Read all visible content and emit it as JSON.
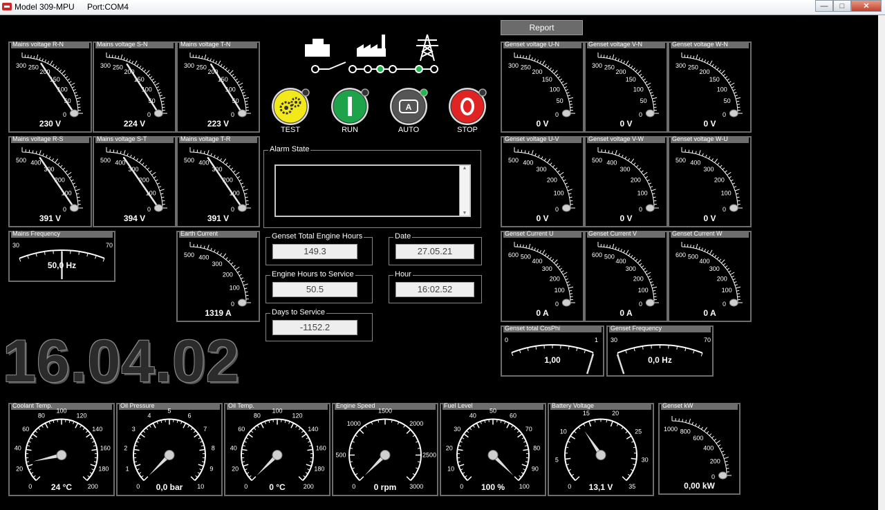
{
  "window": {
    "title": "Model 309-MPU",
    "port": "Port:COM4"
  },
  "report_label": "Report",
  "clock": "16.04.02",
  "modes": [
    {
      "label": "TEST",
      "color": "#f2e81a",
      "icon": "gears-icon"
    },
    {
      "label": "RUN",
      "color": "#1ea34a",
      "icon": "run-icon"
    },
    {
      "label": "AUTO",
      "color": "#555555",
      "icon": "auto-icon"
    },
    {
      "label": "STOP",
      "color": "#e02424",
      "icon": "stop-icon"
    }
  ],
  "alarm_state": {
    "label": "Alarm State",
    "value": ""
  },
  "fields": [
    {
      "id": "engine-hours",
      "label": "Genset Total Engine Hours",
      "value": "149.3"
    },
    {
      "id": "date",
      "label": "Date",
      "value": "27.05.21"
    },
    {
      "id": "service-hours",
      "label": "Engine Hours to Service",
      "value": "50.5"
    },
    {
      "id": "hour",
      "label": "Hour",
      "value": "16:02.52"
    },
    {
      "id": "days-service",
      "label": "Days to Service",
      "value": "-1152.2"
    }
  ],
  "mains_gauges": [
    {
      "title": "Mains voltage R-N",
      "ticks": [
        "0",
        "50",
        "100",
        "150",
        "200",
        "250",
        "300"
      ],
      "max": 300,
      "value": 230,
      "display": "230 V"
    },
    {
      "title": "Mains voltage S-N",
      "ticks": [
        "0",
        "50",
        "100",
        "150",
        "200",
        "250",
        "300"
      ],
      "max": 300,
      "value": 224,
      "display": "224 V"
    },
    {
      "title": "Mains voltage T-N",
      "ticks": [
        "0",
        "50",
        "100",
        "150",
        "200",
        "250",
        "300"
      ],
      "max": 300,
      "value": 223,
      "display": "223 V"
    },
    {
      "title": "Mains voltage R-S",
      "ticks": [
        "0",
        "100",
        "200",
        "300",
        "400",
        "500"
      ],
      "max": 500,
      "value": 391,
      "display": "391 V"
    },
    {
      "title": "Mains voltage S-T",
      "ticks": [
        "0",
        "100",
        "200",
        "300",
        "400",
        "500"
      ],
      "max": 500,
      "value": 394,
      "display": "394 V"
    },
    {
      "title": "Mains voltage T-R",
      "ticks": [
        "0",
        "100",
        "200",
        "300",
        "400",
        "500"
      ],
      "max": 500,
      "value": 391,
      "display": "391 V"
    },
    {
      "title": "Earth Current",
      "ticks": [
        "0",
        "100",
        "200",
        "300",
        "400",
        "500"
      ],
      "max": 500,
      "value": 0,
      "display": "1319 A"
    }
  ],
  "genset_gauges": [
    {
      "title": "Genset voltage U-N",
      "ticks": [
        "0",
        "50",
        "100",
        "150",
        "200",
        "250",
        "300"
      ],
      "max": 300,
      "value": 0,
      "display": "0 V"
    },
    {
      "title": "Genset voltage V-N",
      "ticks": [
        "0",
        "50",
        "100",
        "150",
        "200",
        "250",
        "300"
      ],
      "max": 300,
      "value": 0,
      "display": "0 V"
    },
    {
      "title": "Genset voltage W-N",
      "ticks": [
        "0",
        "50",
        "100",
        "150",
        "200",
        "250",
        "300"
      ],
      "max": 300,
      "value": 0,
      "display": "0 V"
    },
    {
      "title": "Genset voltage U-V",
      "ticks": [
        "0",
        "100",
        "200",
        "300",
        "400",
        "500"
      ],
      "max": 500,
      "value": 0,
      "display": "0 V"
    },
    {
      "title": "Genset voltage V-W",
      "ticks": [
        "0",
        "100",
        "200",
        "300",
        "400",
        "500"
      ],
      "max": 500,
      "value": 0,
      "display": "0 V"
    },
    {
      "title": "Genset voltage W-U",
      "ticks": [
        "0",
        "100",
        "200",
        "300",
        "400",
        "500"
      ],
      "max": 500,
      "value": 0,
      "display": "0 V"
    },
    {
      "title": "Genset Current U",
      "ticks": [
        "0",
        "100",
        "200",
        "300",
        "400",
        "500",
        "600"
      ],
      "max": 600,
      "value": 0,
      "display": "0 A"
    },
    {
      "title": "Genset Current V",
      "ticks": [
        "0",
        "100",
        "200",
        "300",
        "400",
        "500",
        "600"
      ],
      "max": 600,
      "value": 0,
      "display": "0 A"
    },
    {
      "title": "Genset Current W",
      "ticks": [
        "0",
        "100",
        "200",
        "300",
        "400",
        "500",
        "600"
      ],
      "max": 600,
      "value": 0,
      "display": "0 A"
    }
  ],
  "arc_gauges": [
    {
      "title": "Mains Frequency",
      "min_label": "30",
      "max_label": "70",
      "fraction": 0.5,
      "display": "50,0 Hz"
    },
    {
      "title": "Genset total CosPhi",
      "min_label": "0",
      "max_label": "1",
      "fraction": 1.0,
      "display": "1,00"
    },
    {
      "title": "Genset Frequency",
      "min_label": "30",
      "max_label": "70",
      "fraction": 0.0,
      "display": "0,0 Hz"
    }
  ],
  "engine_gauges": [
    {
      "title": "Coolant Temp.",
      "ticks": [
        "0",
        "20",
        "40",
        "60",
        "80",
        "100",
        "120",
        "140",
        "160",
        "180",
        "200"
      ],
      "fraction": 0.12,
      "display": "24 °C"
    },
    {
      "title": "Oil Pressure",
      "ticks": [
        "0",
        "1",
        "2",
        "3",
        "4",
        "5",
        "6",
        "7",
        "8",
        "9",
        "10"
      ],
      "fraction": 0.0,
      "display": "0,0 bar"
    },
    {
      "title": "Oil Temp.",
      "ticks": [
        "0",
        "20",
        "40",
        "60",
        "80",
        "100",
        "120",
        "140",
        "160",
        "180",
        "200"
      ],
      "fraction": 0.0,
      "display": "0 °C"
    },
    {
      "title": "Engine Speed",
      "ticks": [
        "0",
        "500",
        "1000",
        "1500",
        "2000",
        "2500",
        "3000"
      ],
      "fraction": 0.0,
      "display": "0 rpm"
    },
    {
      "title": "Fuel Level",
      "ticks": [
        "0",
        "10",
        "20",
        "30",
        "40",
        "50",
        "60",
        "70",
        "80",
        "90",
        "100"
      ],
      "fraction": 1.0,
      "display": "100 %"
    },
    {
      "title": "Battery Voltage",
      "ticks": [
        "0",
        "5",
        "10",
        "15",
        "20",
        "25",
        "30",
        "35"
      ],
      "fraction": 0.374,
      "display": "13,1 V"
    }
  ],
  "kw_gauge": {
    "title": "Genset kW",
    "ticks": [
      "0",
      "200",
      "400",
      "600",
      "800",
      "1000"
    ],
    "max": 1000,
    "value": 0,
    "display": "0,00 kW"
  }
}
